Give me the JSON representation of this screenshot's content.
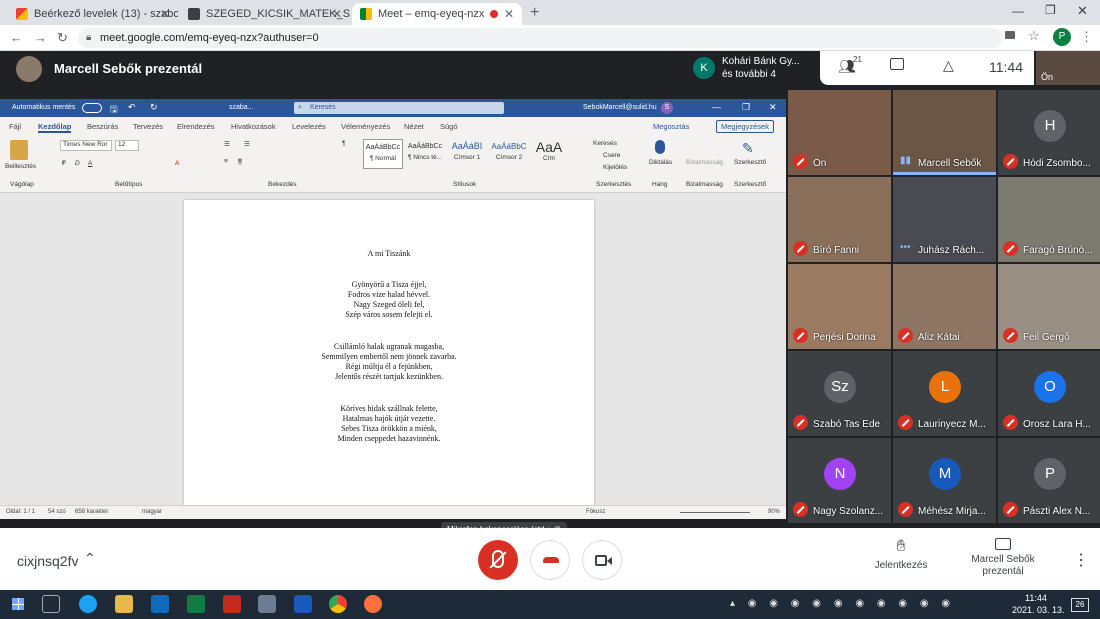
{
  "browser": {
    "tabs": [
      {
        "title": "Beérkező levelek (13) - szabone...",
        "icon": "gmail-icon"
      },
      {
        "title": "SZEGED_KICSIK_MATEK_SZ3_202...",
        "icon": "docs-icon"
      },
      {
        "title": "Meet – emq-eyeq-nzx",
        "icon": "meet-icon"
      }
    ],
    "url": "meet.google.com/emq-eyeq-nzx?authuser=0",
    "profile_initial": "P"
  },
  "meet": {
    "presenter_text": "Marcell Sebők prezentál",
    "pinned": {
      "initial": "K",
      "line1": "Kohári Bánk Gy...",
      "line2": "és további 4"
    },
    "participants_count": "21",
    "clock": "11:44",
    "self_label": "Ön",
    "meeting_code": "cixjnsq2fv",
    "tooltip": "Mikrofon bekapcsolása (ctrl + d)",
    "raise_hand": "Jelentkezés",
    "presenting": "Marcell Sebők prezentál",
    "tiles": [
      {
        "name": "Ön",
        "type": "video",
        "bg": "#7a5a48"
      },
      {
        "name": "Marcell Sebők",
        "type": "video",
        "bg": "#6b5646",
        "speaking": true
      },
      {
        "name": "Hódi Zsombo...",
        "type": "avatar",
        "initial": "H",
        "color": "#5f6368"
      },
      {
        "name": "Bíró Fanni",
        "type": "video",
        "bg": "#8a6f5a"
      },
      {
        "name": "Juhász Rách...",
        "type": "video",
        "bg": "#4a4a52"
      },
      {
        "name": "Faragó Brúnó...",
        "type": "video",
        "bg": "#7d7a70"
      },
      {
        "name": "Perjési Dorina",
        "type": "video",
        "bg": "#9b7a62"
      },
      {
        "name": "Aliz Kátai",
        "type": "video",
        "bg": "#8d7764"
      },
      {
        "name": "Feil Gergő",
        "type": "video",
        "bg": "#9a8f84"
      },
      {
        "name": "Szabó Tas Ede",
        "type": "avatar",
        "initial": "Sz",
        "color": "#5f6368"
      },
      {
        "name": "Laurinyecz M...",
        "type": "avatar",
        "initial": "L",
        "color": "#e8710a"
      },
      {
        "name": "Orosz Lara H...",
        "type": "avatar",
        "initial": "O",
        "color": "#1a73e8"
      },
      {
        "name": "Nagy Szolanz...",
        "type": "avatar",
        "initial": "N",
        "color": "#a142f4"
      },
      {
        "name": "Méhész Mirja...",
        "type": "avatar",
        "initial": "M",
        "color": "#185abc"
      },
      {
        "name": "Pászti Alex N...",
        "type": "avatar",
        "initial": "P",
        "color": "#5f6368"
      }
    ]
  },
  "word": {
    "autosave": "Automatikus mentés",
    "filename": "szaba...",
    "search": "Keresés",
    "user": "SebokMarcell@sulid.hu",
    "user_initial": "S",
    "menu": [
      "Fájl",
      "Kezdőlap",
      "Beszúrás",
      "Tervezés",
      "Elrendezés",
      "Hivatkozások",
      "Levelezés",
      "Véleményezés",
      "Nézet",
      "Súgó"
    ],
    "share": "Megosztás",
    "comments": "Megjegyzések",
    "font": "Times New Ror",
    "size": "12",
    "groups": [
      "Vágólap",
      "Betűtípus",
      "Bekezdés",
      "Stílusok",
      "Szerkesztés",
      "Hang",
      "Bizalmasság",
      "Szerkesztő"
    ],
    "paste": "Beillesztés",
    "styles": [
      {
        "sample": "AaÁáBbCc",
        "label": "¶ Normál"
      },
      {
        "sample": "AaÁáBbCc",
        "label": "¶ Nincs té..."
      },
      {
        "sample": "AaÁáBI",
        "label": "Címsor 1"
      },
      {
        "sample": "AaÁáBbC",
        "label": "Címsor 2"
      },
      {
        "sample": "AaA",
        "label": "Cím"
      }
    ],
    "edit": [
      "Keresés",
      "Csere",
      "Kijelölés"
    ],
    "dictate": "Diktálás",
    "sensitivity": "Bizalmasság",
    "editor": "Szerkesztő",
    "doc": {
      "title": "A mi Tiszánk",
      "stanzas": [
        [
          "Gyönyörű a Tisza éjjel,",
          "Fodros vize halad hévvel.",
          "Nagy Szeged öleli fel,",
          "Szép város sosem felejti el."
        ],
        [
          "Csillámló halak ugranak magasba,",
          "Semmilyen embertől nem jönnek zavarba.",
          "Régi múltja él a fejünkben,",
          "Jelentős részét tartjuk kezünkben."
        ],
        [
          "Köríves hidak szállnak felette,",
          "Hatalmas hajók útját vezette.",
          "Sebes Tisza örökkön a miénk,",
          "Minden cseppedet hazavinnénk."
        ]
      ]
    },
    "status": {
      "page": "Oldal: 1 / 1",
      "words": "54 szó",
      "chars": "658 karakter",
      "lang": "magyar",
      "focus": "Fókusz",
      "zoom": "90%"
    }
  },
  "taskbar": {
    "time": "11:44",
    "date": "2021. 03. 13.",
    "notif": "26"
  }
}
